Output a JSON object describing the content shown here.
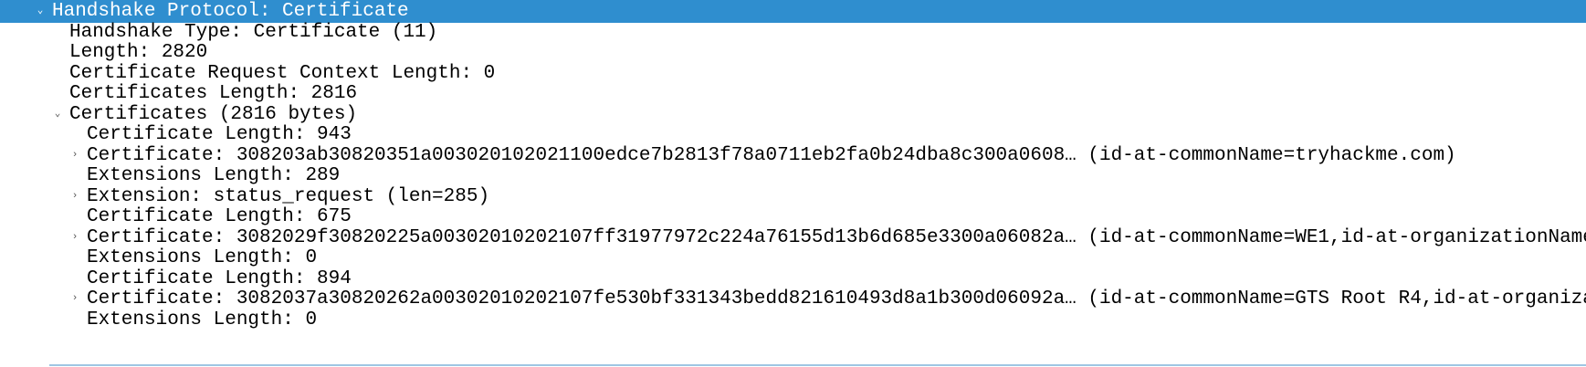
{
  "colors": {
    "selection_background": "#2f8ecf",
    "selection_text": "#ffffff",
    "text": "#000000"
  },
  "icons": {
    "expanded": "chevron-down-icon",
    "collapsed": "chevron-right-icon"
  },
  "expander_glyphs": {
    "expanded": "⌄",
    "collapsed": "›"
  },
  "tree": [
    {
      "label": "Handshake Protocol: Certificate",
      "expander": "expanded",
      "selected": true
    },
    {
      "label": "Handshake Type: Certificate (11)"
    },
    {
      "label": "Length: 2820"
    },
    {
      "label": "Certificate Request Context Length: 0"
    },
    {
      "label": "Certificates Length: 2816"
    },
    {
      "label": "Certificates (2816 bytes)",
      "expander": "expanded"
    },
    {
      "label": "Certificate Length: 943"
    },
    {
      "label": "Certificate: 308203ab30820351a003020102021100edce7b2813f78a0711eb2fa0b24dba8c300a0608… (id-at-commonName=tryhackme.com)",
      "expander": "collapsed"
    },
    {
      "label": "Extensions Length: 289"
    },
    {
      "label": "Extension: status_request (len=285)",
      "expander": "collapsed"
    },
    {
      "label": "Certificate Length: 675"
    },
    {
      "label": "Certificate: 3082029f30820225a00302010202107ff31977972c224a76155d13b6d685e3300a06082a… (id-at-commonName=WE1,id-at-organizationName",
      "expander": "collapsed"
    },
    {
      "label": "Extensions Length: 0"
    },
    {
      "label": "Certificate Length: 894"
    },
    {
      "label": "Certificate: 3082037a30820262a00302010202107fe530bf331343bedd821610493d8a1b300d06092a… (id-at-commonName=GTS Root R4,id-at-organiza",
      "expander": "collapsed"
    },
    {
      "label": "Extensions Length: 0"
    }
  ]
}
